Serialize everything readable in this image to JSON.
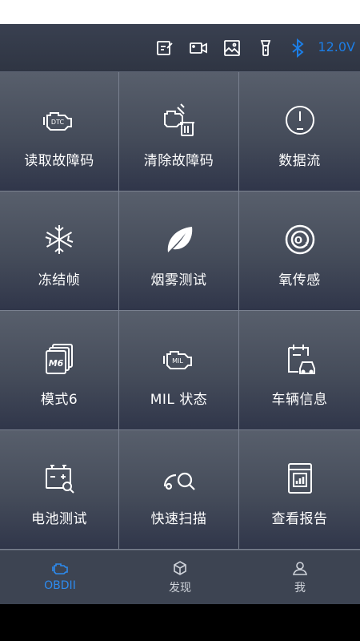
{
  "toolbar": {
    "icons": [
      "edit-icon",
      "video-camera-icon",
      "image-icon",
      "flashlight-icon",
      "bluetooth-icon"
    ],
    "voltage": "12.0V",
    "accent": "#1c7ee6"
  },
  "menu": {
    "items": [
      {
        "label": "读取故障码",
        "icon": "engine-dtc-icon"
      },
      {
        "label": "清除故障码",
        "icon": "engine-clear-trash-icon"
      },
      {
        "label": "数据流",
        "icon": "gauge-icon"
      },
      {
        "label": "冻结帧",
        "icon": "snowflake-icon"
      },
      {
        "label": "烟雾测试",
        "icon": "leaf-icon"
      },
      {
        "label": "氧传感",
        "icon": "oxygen-sensor-icon"
      },
      {
        "label": "模式6",
        "icon": "mode6-stack-icon"
      },
      {
        "label": "MIL 状态",
        "icon": "engine-mil-icon"
      },
      {
        "label": "车辆信息",
        "icon": "vehicle-info-icon"
      },
      {
        "label": "电池测试",
        "icon": "battery-search-icon"
      },
      {
        "label": "快速扫描",
        "icon": "quick-scan-icon"
      },
      {
        "label": "查看报告",
        "icon": "report-icon"
      }
    ]
  },
  "tabs": [
    {
      "label": "OBDII",
      "icon": "engine-tab-icon",
      "active": true
    },
    {
      "label": "发现",
      "icon": "discover-cube-icon",
      "active": false
    },
    {
      "label": "我",
      "icon": "user-icon",
      "active": false
    }
  ],
  "colors": {
    "active_tab": "#2d8bef",
    "bluetooth": "#1c7ee6"
  }
}
